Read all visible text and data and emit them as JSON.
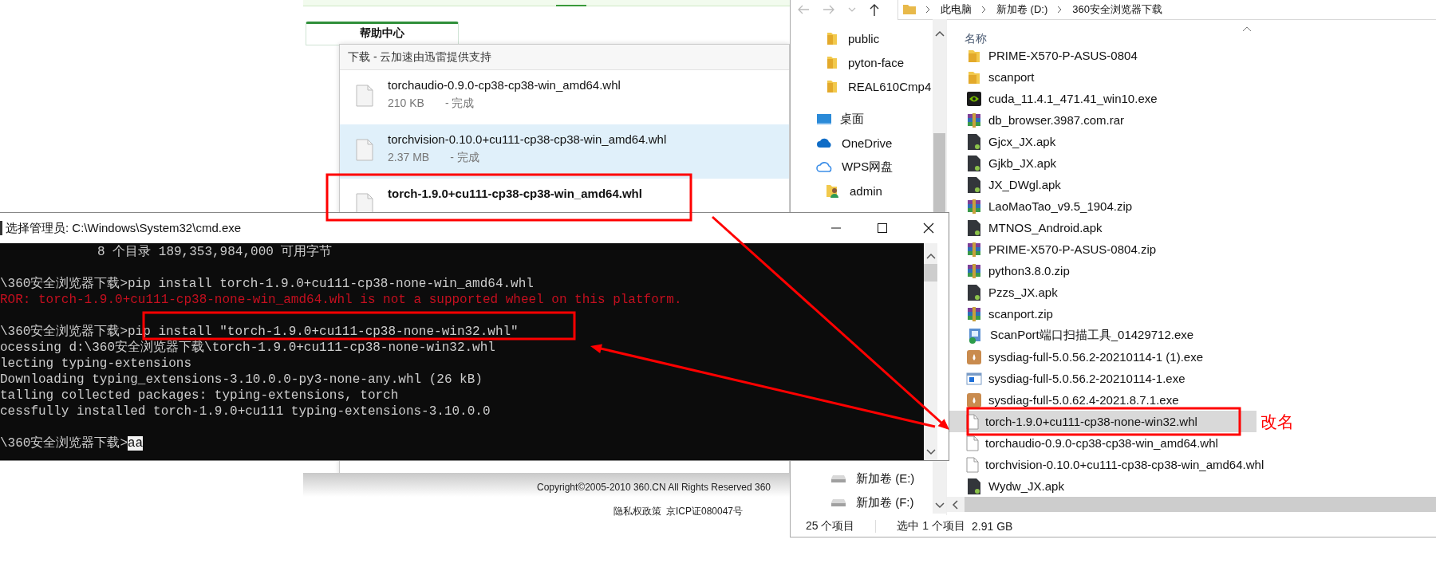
{
  "browser": {
    "help_tab": "帮助中心",
    "copyright": "Copyright©2005-2010 360.CN All Rights Reserved 360",
    "links": [
      "隐私权政策",
      "京ICP证080047号"
    ]
  },
  "download_panel": {
    "title": "下载 - 云加速由迅雷提供支持",
    "items": [
      {
        "name": "torchaudio-0.9.0-cp38-cp38-win_amd64.whl",
        "size": "210 KB",
        "status": "- 完成",
        "selected": false,
        "bold": false
      },
      {
        "name": "torchvision-0.10.0+cu111-cp38-cp38-win_amd64.whl",
        "size": "2.37 MB",
        "status": "- 完成",
        "selected": true,
        "bold": false
      },
      {
        "name": "torch-1.9.0+cu111-cp38-cp38-win_amd64.whl",
        "selected": false,
        "bold": true
      }
    ]
  },
  "cmd": {
    "title": "选择管理员: C:\\Windows\\System32\\cmd.exe",
    "lines": [
      {
        "kind": "info",
        "text": "8 个目录 189,353,984,000 可用字节"
      },
      {
        "kind": "prompt",
        "prompt": "\\360安全浏览器下载>",
        "command": "pip install torch-1.9.0+cu111-cp38-none-win_amd64.whl",
        "highlighted": false
      },
      {
        "kind": "error",
        "text": "ROR: torch-1.9.0+cu111-cp38-none-win_amd64.whl is not a supported wheel on this platform."
      },
      {
        "kind": "prompt",
        "prompt": "\\360安全浏览器下载>",
        "command": "pip install \"torch-1.9.0+cu111-cp38-none-win32.whl\"",
        "highlighted": false
      },
      {
        "kind": "output",
        "text": "ocessing d:\\360安全浏览器下载\\torch-1.9.0+cu111-cp38-none-win32.whl"
      },
      {
        "kind": "output",
        "text": "lecting typing-extensions"
      },
      {
        "kind": "output",
        "text": "Downloading typing_extensions-3.10.0.0-py3-none-any.whl (26 kB)"
      },
      {
        "kind": "output",
        "text": "talling collected packages: typing-extensions, torch"
      },
      {
        "kind": "output",
        "text": "cessfully installed torch-1.9.0+cu111 typing-extensions-3.10.0.0"
      },
      {
        "kind": "prompt",
        "prompt": "\\360安全浏览器下载>",
        "command": "aa",
        "highlighted": true
      }
    ]
  },
  "explorer": {
    "breadcrumb": [
      "此电脑",
      "新加卷 (D:)",
      "360安全浏览器下载"
    ],
    "nav_top": [
      {
        "kind": "folder",
        "label": "public"
      },
      {
        "kind": "folder",
        "label": "pyton-face"
      },
      {
        "kind": "folder",
        "label": "REAL610Cmp4"
      },
      {
        "kind": "desktop",
        "label": "桌面"
      },
      {
        "kind": "cloud",
        "label": "OneDrive"
      },
      {
        "kind": "cloud-outline",
        "label": "WPS网盘"
      },
      {
        "kind": "user",
        "label": "admin"
      }
    ],
    "nav_bottom": [
      {
        "kind": "drive",
        "label": "新加卷 (E:)"
      },
      {
        "kind": "drive",
        "label": "新加卷 (F:)"
      }
    ],
    "column_header": "名称",
    "files": [
      {
        "kind": "folder",
        "name": "PRIME-X570-P-ASUS-0804",
        "selected": false
      },
      {
        "kind": "folder",
        "name": "scanport",
        "selected": false
      },
      {
        "kind": "gpu",
        "name": "cuda_11.4.1_471.41_win10.exe",
        "selected": false
      },
      {
        "kind": "archive",
        "name": "db_browser.3987.com.rar",
        "selected": false
      },
      {
        "kind": "apk",
        "name": "Gjcx_JX.apk",
        "selected": false
      },
      {
        "kind": "apk",
        "name": "Gjkb_JX.apk",
        "selected": false
      },
      {
        "kind": "apk",
        "name": "JX_DWgl.apk",
        "selected": false
      },
      {
        "kind": "archive",
        "name": "LaoMaoTao_v9.5_1904.zip",
        "selected": false
      },
      {
        "kind": "apk",
        "name": "MTNOS_Android.apk",
        "selected": false
      },
      {
        "kind": "archive",
        "name": "PRIME-X570-P-ASUS-0804.zip",
        "selected": false
      },
      {
        "kind": "archive",
        "name": "python3.8.0.zip",
        "selected": false
      },
      {
        "kind": "apk",
        "name": "Pzzs_JX.apk",
        "selected": false
      },
      {
        "kind": "archive",
        "name": "scanport.zip",
        "selected": false
      },
      {
        "kind": "installer",
        "name": "ScanPort端口扫描工具_01429712.exe",
        "selected": false
      },
      {
        "kind": "box",
        "name": "sysdiag-full-5.0.56.2-20210114-1 (1).exe",
        "selected": false
      },
      {
        "kind": "window",
        "name": "sysdiag-full-5.0.56.2-20210114-1.exe",
        "selected": false
      },
      {
        "kind": "box",
        "name": "sysdiag-full-5.0.62.4-2021.8.7.1.exe",
        "selected": false
      },
      {
        "kind": "file",
        "name": "torch-1.9.0+cu111-cp38-none-win32.whl",
        "selected": true
      },
      {
        "kind": "file",
        "name": "torchaudio-0.9.0-cp38-cp38-win_amd64.whl",
        "selected": false
      },
      {
        "kind": "file",
        "name": "torchvision-0.10.0+cu111-cp38-cp38-win_amd64.whl",
        "selected": false
      },
      {
        "kind": "apk",
        "name": "Wydw_JX.apk",
        "selected": false
      }
    ],
    "status": {
      "count": "25 个项目",
      "selection": "选中 1 个项目",
      "size": "2.91 GB"
    }
  },
  "annotation": {
    "note": "改名"
  }
}
